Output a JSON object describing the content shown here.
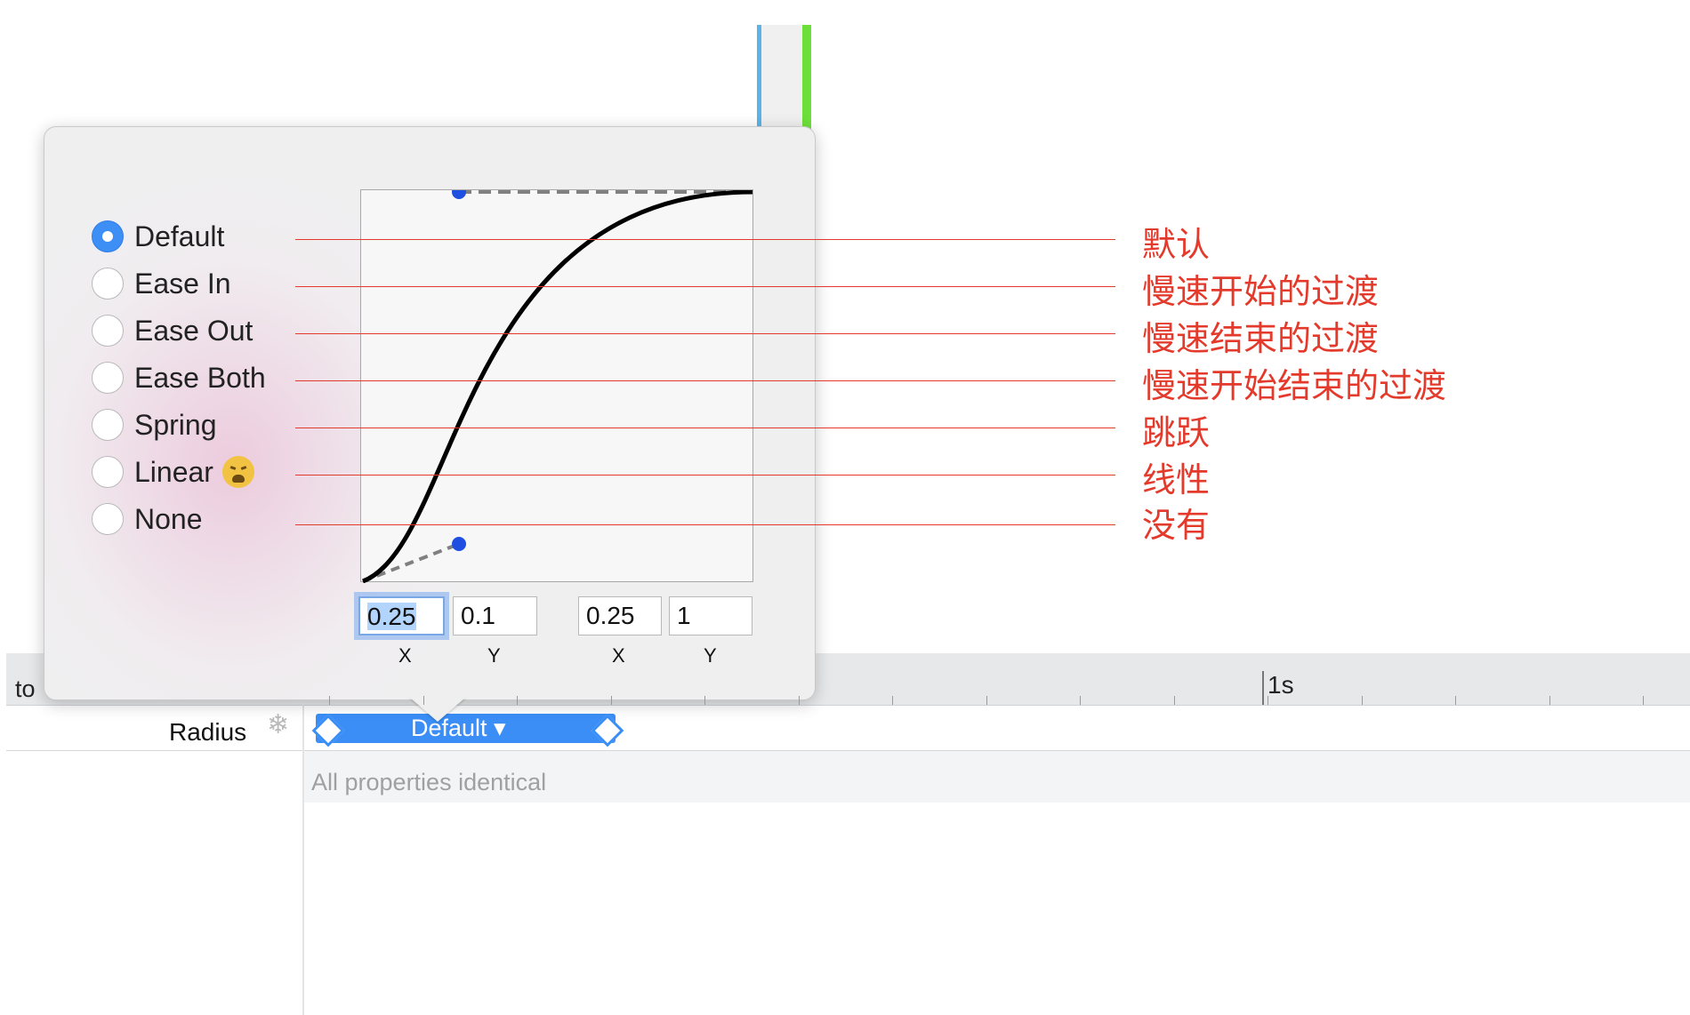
{
  "timeline": {
    "ruler_start_label": "to",
    "ruler_mark_label": "1s",
    "row_label": "Radius",
    "track_label": "Default ▾",
    "identical_text": "All properties identical"
  },
  "curve_popover": {
    "options": [
      {
        "label": "Default",
        "selected": true
      },
      {
        "label": "Ease In",
        "selected": false
      },
      {
        "label": "Ease Out",
        "selected": false
      },
      {
        "label": "Ease Both",
        "selected": false
      },
      {
        "label": "Spring",
        "selected": false
      },
      {
        "label": "Linear",
        "selected": false,
        "emoji": "weary-face-icon"
      },
      {
        "label": "None",
        "selected": false
      }
    ],
    "control_points": {
      "p1_x": "0.25",
      "p1_y": "0.1",
      "p2_x": "0.25",
      "p2_y": "1",
      "x_label": "X",
      "y_label": "Y"
    }
  },
  "annotations": [
    "默认",
    "慢速开始的过渡",
    "慢速结束的过渡",
    "慢速开始结束的过渡",
    "跳跃",
    "线性",
    "没有"
  ],
  "colors": {
    "accent": "#3d8ef5",
    "annotation": "#e33a2c",
    "control_point": "#1f4fe0",
    "timeline_blue": "#5ab4ea",
    "timeline_green": "#6ddf3a"
  }
}
